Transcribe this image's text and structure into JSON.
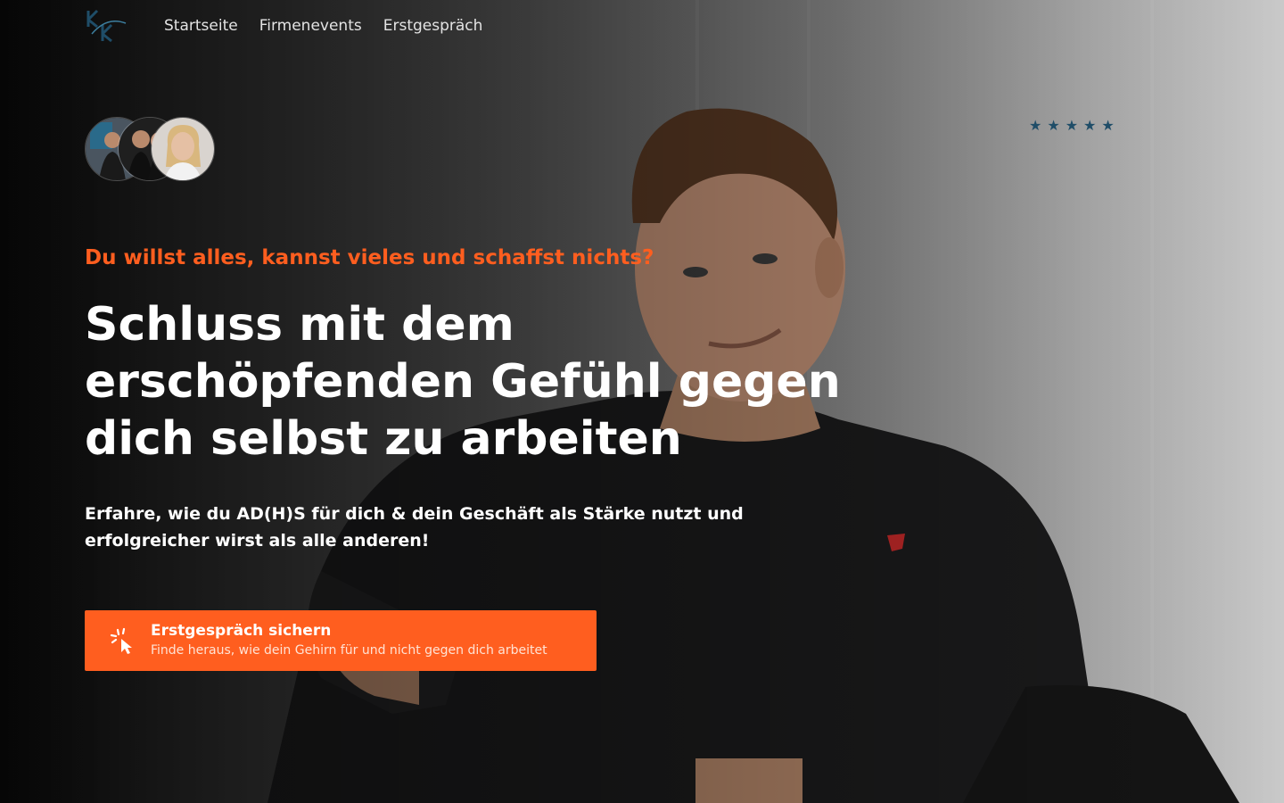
{
  "nav": {
    "items": [
      {
        "label": "Startseite"
      },
      {
        "label": "Firmenevents"
      },
      {
        "label": "Erstgespräch"
      }
    ]
  },
  "rating": {
    "stars": 5
  },
  "hero": {
    "eyebrow": "Du willst alles, kannst vieles und schaffst nichts?",
    "headline": "Schluss mit dem erschöpfenden Gefühl gegen dich selbst zu arbeiten",
    "subheadline": "Erfahre, wie du AD(H)S für dich & dein Geschäft als Stärke nutzt und erfolgreicher wirst als alle anderen!",
    "cta": {
      "title": "Erstgespräch sichern",
      "subtitle": "Finde heraus, wie dein Gehirn für und nicht gegen dich arbeitet"
    }
  },
  "colors": {
    "accent": "#ff5e1f",
    "star": "#1f4d68",
    "text": "#ffffff"
  },
  "icons": {
    "logo": "kk-monogram-logo",
    "cta": "cursor-click-icon",
    "star": "star-icon"
  }
}
